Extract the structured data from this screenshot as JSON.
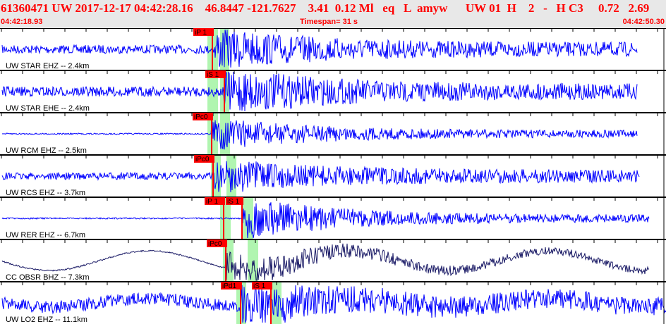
{
  "header": {
    "title": "61360471 UW 2017-12-17 04:42:28.16    46.8447 -121.7627    3.41  0.12 Ml   eq   L  amyw      UW 01  H    2   -   H C3     0.72   2.69",
    "start_time": "04:42:18.93",
    "timespan": "Timespan=  31 s",
    "end_time": "04:42:50.30"
  },
  "colors": {
    "trace": "#0000ff",
    "trace_dark": "#1a1a66",
    "pick": "#ff0000",
    "window": "#b0f5b0"
  },
  "channels": [
    {
      "label": "UW STAR EHZ -- 2.4km",
      "picks": [
        {
          "text": "iP 1"
        }
      ]
    },
    {
      "label": "UW STAR EHE -- 2.4km",
      "picks": [
        {
          "text": "iS 1"
        }
      ]
    },
    {
      "label": "UW RCM EHZ -- 2.5km",
      "picks": [
        {
          "text": "iPc0"
        }
      ]
    },
    {
      "label": "UW RCS EHZ -- 3.7km",
      "picks": [
        {
          "text": "iPc0"
        }
      ]
    },
    {
      "label": "UW RER EHZ -- 6.7km",
      "picks": [
        {
          "text": "iP 1"
        },
        {
          "text": "iS 1"
        }
      ]
    },
    {
      "label": "CC OBSR BHZ -- 7.3km",
      "picks": [
        {
          "text": "iPc0"
        }
      ]
    },
    {
      "label": "UW LO2 EHZ -- 11.1km",
      "picks": [
        {
          "text": "iPd1"
        },
        {
          "text": "iS 1"
        }
      ]
    }
  ]
}
